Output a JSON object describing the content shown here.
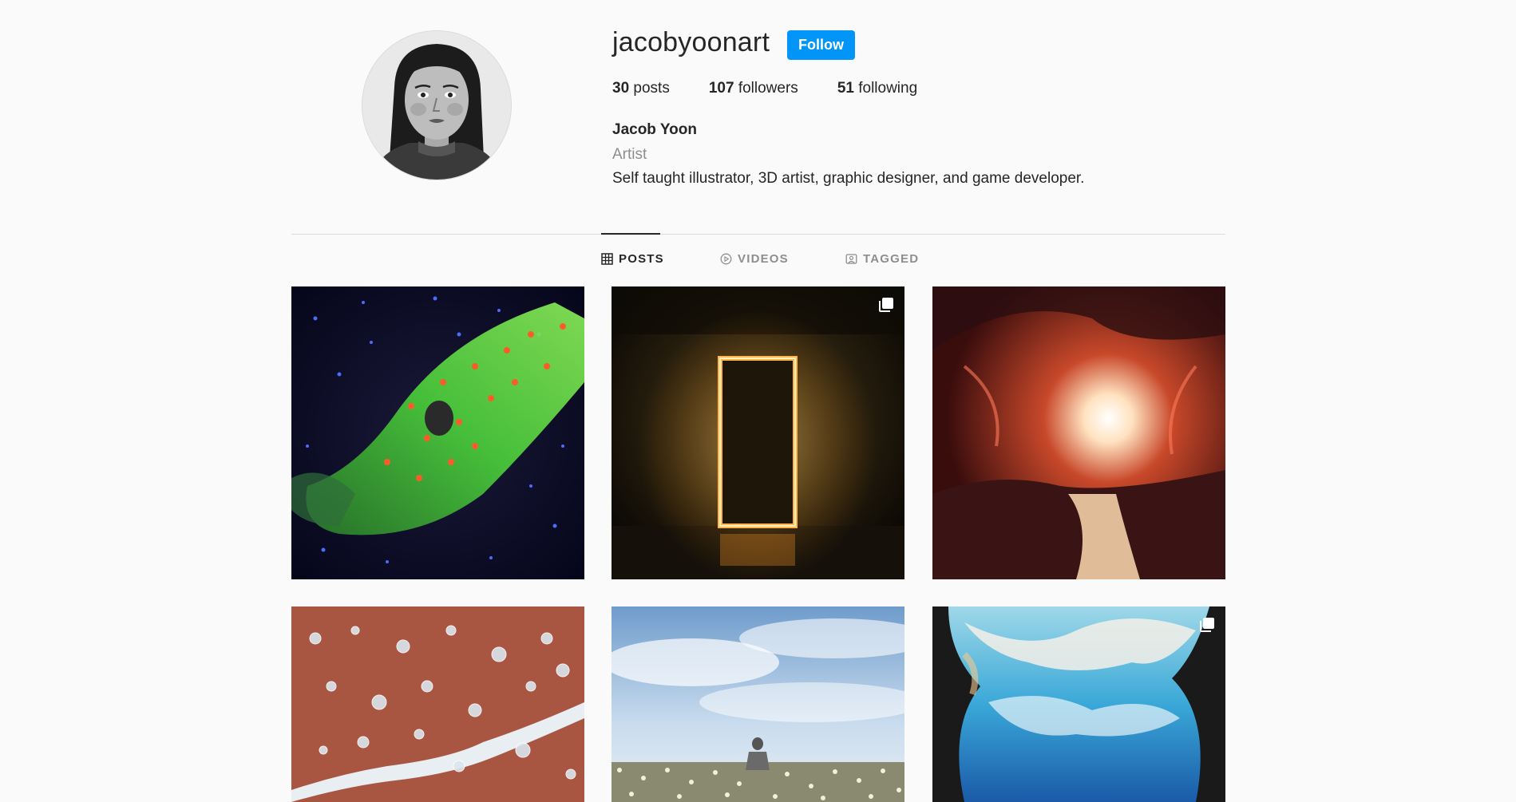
{
  "profile": {
    "username": "jacobyoonart",
    "follow_label": "Follow",
    "stats": {
      "posts_count": "30",
      "posts_label": "posts",
      "followers_count": "107",
      "followers_label": "followers",
      "following_count": "51",
      "following_label": "following"
    },
    "full_name": "Jacob Yoon",
    "category": "Artist",
    "bio": "Self taught illustrator, 3D artist, graphic designer, and game developer."
  },
  "tabs": [
    {
      "label": "POSTS",
      "icon": "grid-icon",
      "active": true
    },
    {
      "label": "VIDEOS",
      "icon": "play-circle-icon",
      "active": false
    },
    {
      "label": "TAGGED",
      "icon": "tagged-icon",
      "active": false
    }
  ],
  "posts": [
    {
      "subject": "hand made of flowers in starry space",
      "multiple": false
    },
    {
      "subject": "glowing orange portal in dark room",
      "multiple": true
    },
    {
      "subject": "red canyon with bright light and river",
      "multiple": false
    },
    {
      "subject": "bubbles over red terrain with stream",
      "multiple": false
    },
    {
      "subject": "metallic figure in flower field under sky",
      "multiple": false
    },
    {
      "subject": "blue and white cloud waterfall",
      "multiple": true
    }
  ],
  "colors": {
    "background": "#fafafa",
    "follow_button": "#0095f6",
    "divider": "#dbdbdb",
    "muted_text": "#8e8e8e",
    "primary_text": "#262626"
  }
}
